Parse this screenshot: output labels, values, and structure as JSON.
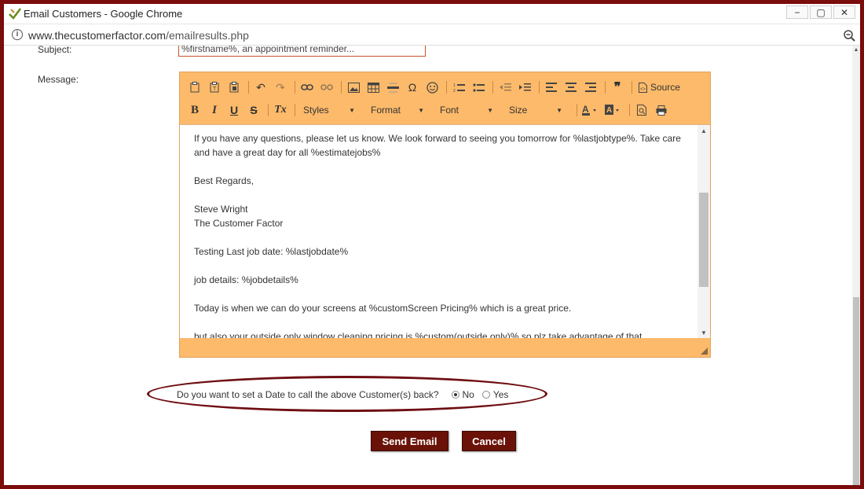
{
  "window": {
    "title": "Email Customers - Google Chrome",
    "url_host": "www.thecustomerfactor.com",
    "url_path": "/emailresults.php",
    "buttons": {
      "minimize": "−",
      "restore": "▢",
      "close": "✕"
    }
  },
  "form": {
    "subject_label": "Subject:",
    "subject_value": "%firstname%, an appointment reminder...",
    "message_label": "Message:"
  },
  "editor": {
    "toolbar": {
      "styles": "Styles",
      "format": "Format",
      "font": "Font",
      "size": "Size",
      "source": "Source",
      "bold": "B",
      "italic": "I",
      "underline": "U",
      "strike": "S",
      "remove_format": "Tx",
      "special_char": "Ω",
      "quote": "❞"
    },
    "content": {
      "line1": "If you have any questions, please let us know. We look forward to seeing you tomorrow for %lastjobtype%. Take care",
      "line2": "and have a great day for all %estimatejobs%",
      "line3": "Best Regards,",
      "line4": "Steve Wright",
      "line5": "The Customer Factor",
      "line6": "Testing Last job date: %lastjobdate%",
      "line7": "job details: %jobdetails%",
      "line8": "Today is when we can do your screens at %customScreen Pricing% which is a great price.",
      "line9": "but also your outside only window cleaning pricing is %custom(outside only)% so plz take advantage of that"
    }
  },
  "callback": {
    "question": "Do you want to set a Date to call the above Customer(s) back?",
    "option_no": "No",
    "option_yes": "Yes",
    "selected": "No"
  },
  "actions": {
    "send": "Send Email",
    "cancel": "Cancel"
  },
  "colors": {
    "frame": "#7a0c0c",
    "toolbar": "#fdba6a",
    "button": "#6b1208",
    "highlight_ring": "#6f0e12"
  }
}
